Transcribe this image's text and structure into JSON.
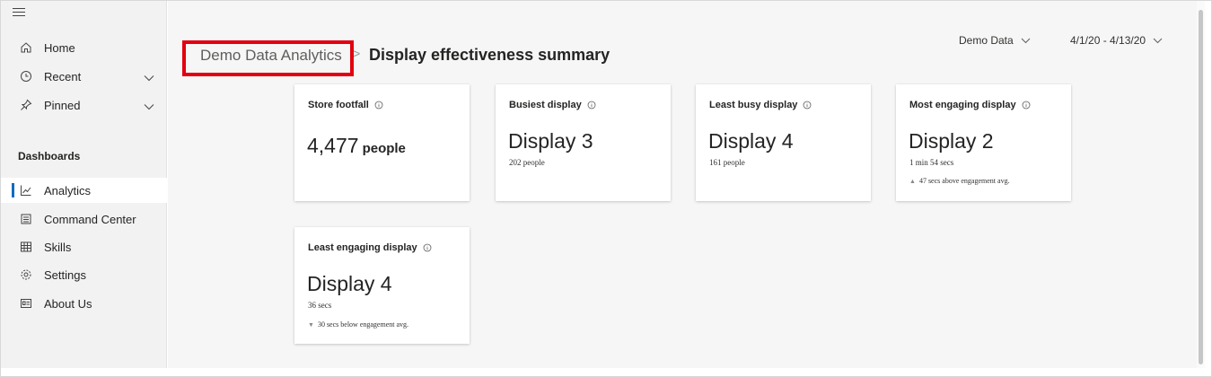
{
  "sidebar": {
    "items": [
      {
        "label": "Home",
        "icon": "home-icon"
      },
      {
        "label": "Recent",
        "icon": "clock-icon"
      },
      {
        "label": "Pinned",
        "icon": "pin-icon"
      }
    ],
    "section_label": "Dashboards",
    "dashboard_items": [
      {
        "label": "Analytics",
        "icon": "line-chart-icon",
        "active": true
      },
      {
        "label": "Command Center",
        "icon": "command-center-icon"
      },
      {
        "label": "Skills",
        "icon": "skills-grid-icon"
      },
      {
        "label": "Settings",
        "icon": "gear-icon"
      },
      {
        "label": "About Us",
        "icon": "contact-card-icon"
      }
    ]
  },
  "header": {
    "breadcrumb_root": "Demo Data Analytics",
    "breadcrumb_separator": ">",
    "page_title": "Display effectiveness summary",
    "data_source": "Demo Data",
    "date_range": "4/1/20 - 4/13/20"
  },
  "cards": [
    {
      "title": "Store footfall",
      "value": "4,477",
      "unit": "people"
    },
    {
      "title": "Busiest display",
      "value": "Display 3",
      "sub": "202 people"
    },
    {
      "title": "Least busy display",
      "value": "Display 4",
      "sub": "161 people"
    },
    {
      "title": "Most engaging display",
      "value": "Display 2",
      "sub": "1 min 54 secs",
      "trend": "47 secs above engagement avg.",
      "trend_direction": "up"
    },
    {
      "title": "Least engaging display",
      "value": "Display 4",
      "sub": "36 secs",
      "trend": "30 secs below engagement avg.",
      "trend_direction": "down"
    }
  ],
  "colors": {
    "accent": "#0f6cbd",
    "highlight": "#e3000f",
    "sidebar_bg": "#f2f2f2",
    "main_bg": "#f6f6f6"
  }
}
